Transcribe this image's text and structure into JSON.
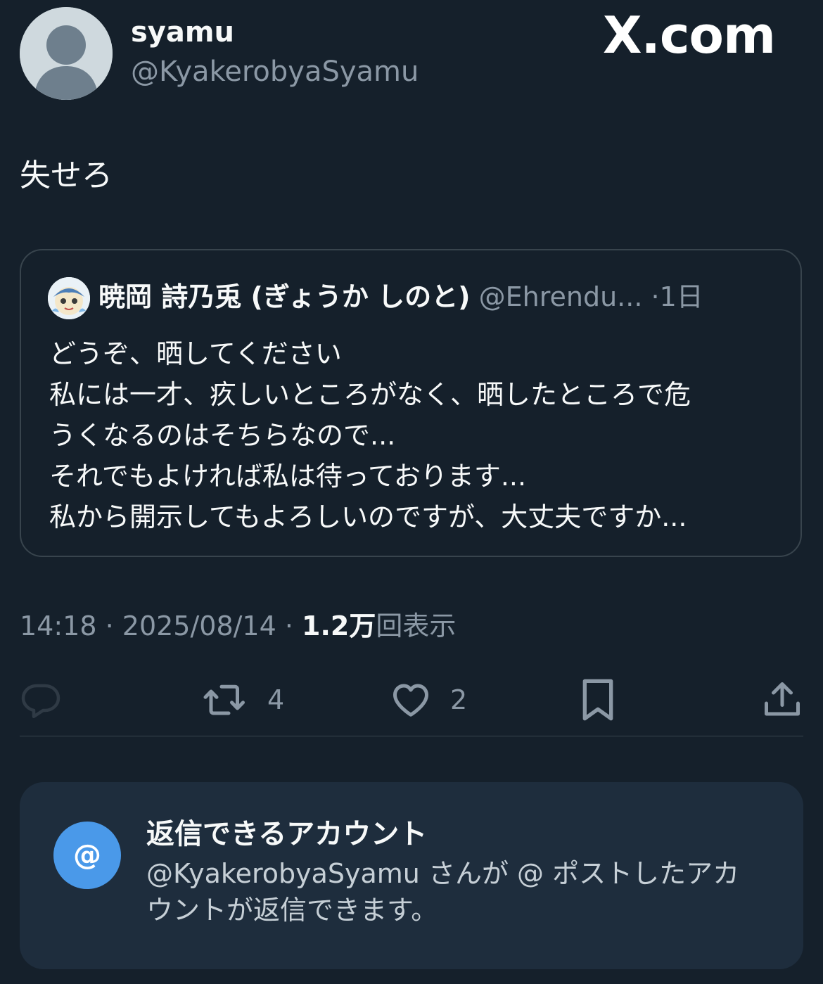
{
  "author": {
    "display_name": "syamu",
    "handle": "@KyakerobyaSyamu"
  },
  "brand": "X.com",
  "tweet": {
    "text": "失せろ"
  },
  "quote": {
    "name": "暁岡 詩乃兎 (ぎょうか しのと)",
    "handle": "@Ehrendu...",
    "separator": "·",
    "time": "1日",
    "lines": [
      "どうぞ、晒してください",
      "私には一才、疚しいところがなく、晒したところで危",
      "うくなるのはそちらなので...",
      "それでもよければ私は待っております...",
      "私から開示してもよろしいのですが、大丈夫ですか..."
    ]
  },
  "meta": {
    "time": "14:18",
    "sep1": " · ",
    "date": "2025/08/14",
    "sep2": " · ",
    "views_count": "1.2万",
    "views_label": "回表示"
  },
  "actions": {
    "retweets": "4",
    "likes": "2"
  },
  "reply_restriction": {
    "icon_text": "@",
    "title": "返信できるアカウント",
    "description": "@KyakerobyaSyamu さんが @ ポストしたアカウントが返信できます。"
  },
  "colors": {
    "background": "#15202b",
    "secondary_text": "#8b98a5",
    "accent": "#4a99e9",
    "card_background": "#1e2d3d"
  }
}
